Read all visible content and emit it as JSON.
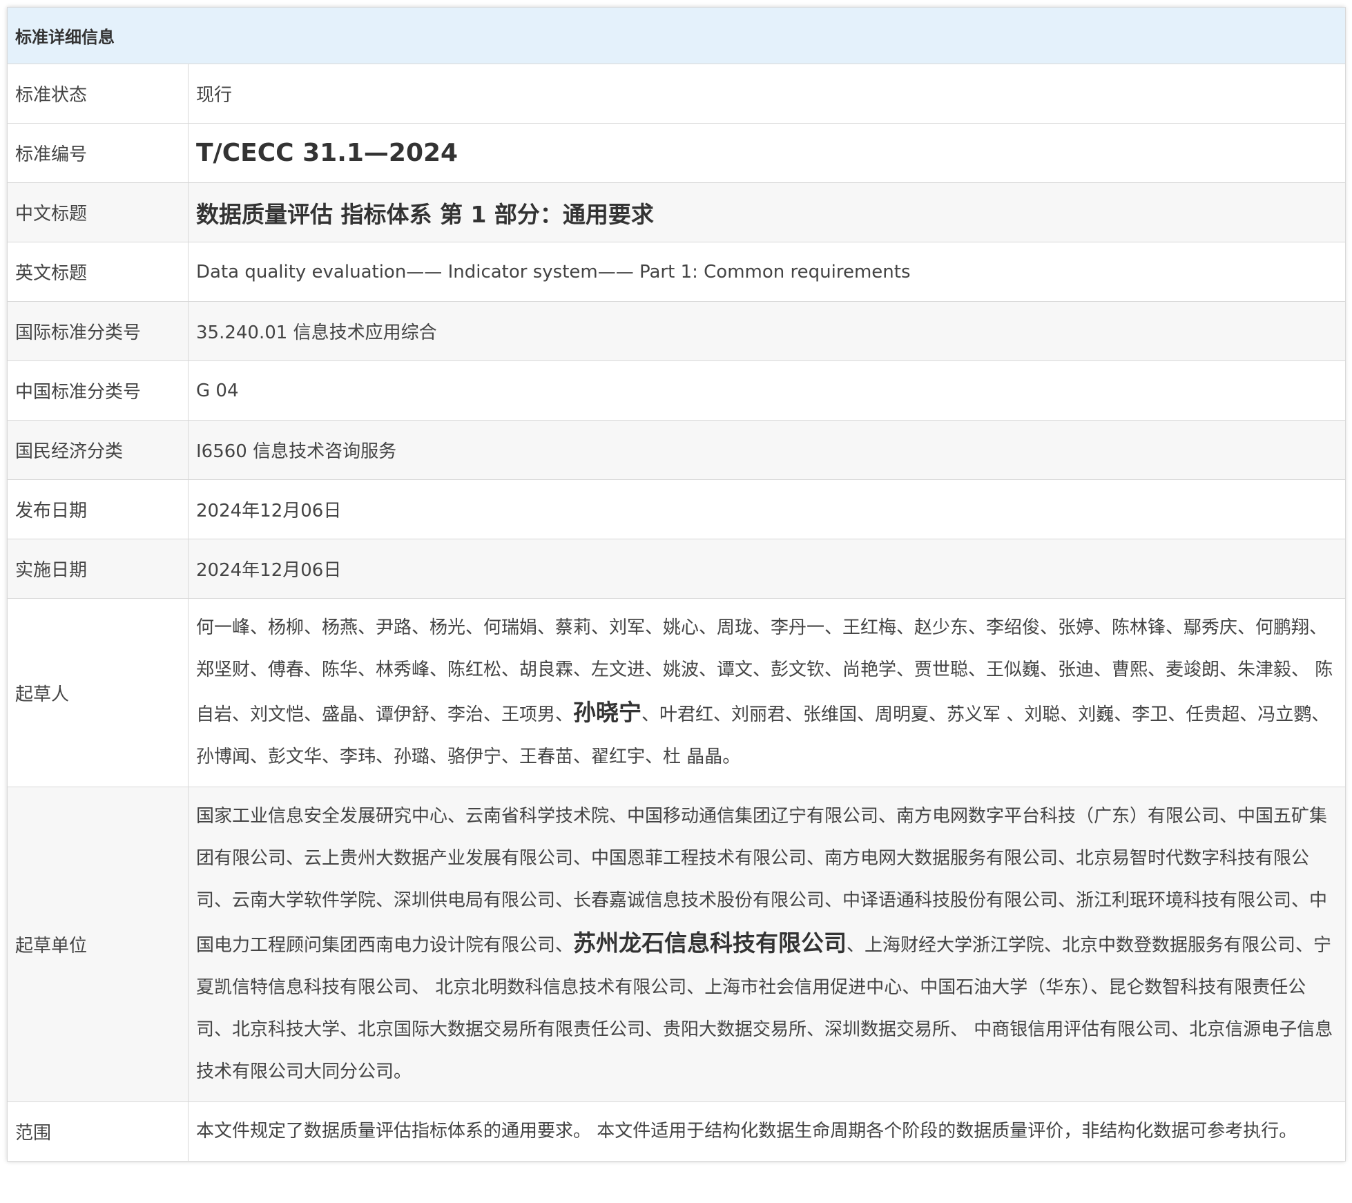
{
  "header": {
    "title": "标准详细信息"
  },
  "rows": {
    "status": {
      "label": "标准状态",
      "value": "现行"
    },
    "code": {
      "label": "标准编号",
      "value": "T/CECC 31.1—2024"
    },
    "cn_title": {
      "label": "中文标题",
      "value": "数据质量评估 指标体系 第 1 部分：通用要求"
    },
    "en_title": {
      "label": "英文标题",
      "value": "Data quality evaluation—— Indicator system—— Part 1: Common requirements"
    },
    "ics": {
      "label": "国际标准分类号",
      "value": "35.240.01 信息技术应用综合"
    },
    "ccs": {
      "label": "中国标准分类号",
      "value": "G 04"
    },
    "economy": {
      "label": "国民经济分类",
      "value": "I6560 信息技术咨询服务"
    },
    "publish_date": {
      "label": "发布日期",
      "value": "2024年12月06日"
    },
    "impl_date": {
      "label": "实施日期",
      "value": "2024年12月06日"
    },
    "drafters": {
      "label": "起草人",
      "before": "何一峰、杨柳、杨燕、尹路、杨光、何瑞娟、蔡莉、刘军、姚心、周珑、李丹一、王红梅、赵少东、李绍俊、张婷、陈林锋、鄢秀庆、何鹏翔、郑坚财、傅春、陈华、林秀峰、陈红松、胡良霖、左文进、姚波、谭文、彭文钦、尚艳学、贾世聪、王似巍、张迪、曹熙、麦竣朗、朱津毅、 陈自岩、刘文恺、盛晶、谭伊舒、李治、王项男、",
      "emph": "孙晓宁",
      "after": "、叶君红、刘丽君、张维国、周明夏、苏义军 、刘聪、刘巍、李卫、任贵超、冯立鹦、孙博闻、彭文华、李玮、孙璐、骆伊宁、王春苗、翟红宇、杜 晶晶。"
    },
    "units": {
      "label": "起草单位",
      "before": "国家工业信息安全发展研究中心、云南省科学技术院、中国移动通信集团辽宁有限公司、南方电网数字平台科技（广东）有限公司、中国五矿集团有限公司、云上贵州大数据产业发展有限公司、中国恩菲工程技术有限公司、南方电网大数据服务有限公司、北京易智时代数字科技有限公司、云南大学软件学院、深圳供电局有限公司、长春嘉诚信息技术股份有限公司、中译语通科技股份有限公司、浙江利珉环境科技有限公司、中国电力工程顾问集团西南电力设计院有限公司、",
      "emph": "苏州龙石信息科技有限公司",
      "after": "、上海财经大学浙江学院、北京中数登数据服务有限公司、宁夏凯信特信息科技有限公司、 北京北明数科信息技术有限公司、上海市社会信用促进中心、中国石油大学（华东）、昆仑数智科技有限责任公司、北京科技大学、北京国际大数据交易所有限责任公司、贵阳大数据交易所、深圳数据交易所、 中商银信用评估有限公司、北京信源电子信息技术有限公司大同分公司。"
    },
    "scope": {
      "label": "范围",
      "value": "本文件规定了数据质量评估指标体系的通用要求。 本文件适用于结构化数据生命周期各个阶段的数据质量评价，非结构化数据可参考执行。"
    }
  }
}
